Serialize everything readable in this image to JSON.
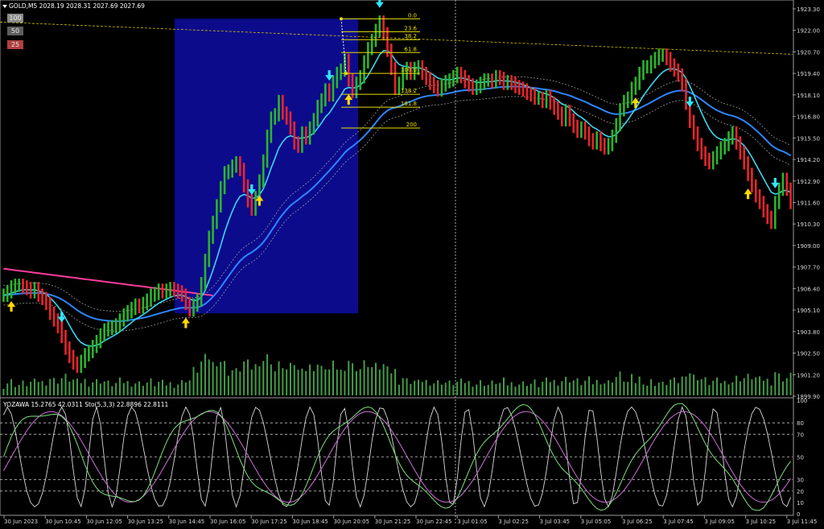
{
  "header": {
    "symbol_line": "GOLD,M5  2028.19 2028.31 2027.69 2027.69",
    "sub_line": "YOZAWA 15.2765 42.0311   Sto(5,3,3) 22.8896 22.8111"
  },
  "buttons": [
    {
      "label": "100",
      "bg": "#8a8a8a"
    },
    {
      "label": "50",
      "bg": "#5e5e5e"
    },
    {
      "label": "25",
      "bg": "#b04040"
    }
  ],
  "chart_data": {
    "type": "line",
    "price_axis": {
      "ticks": [
        "1923.30",
        "1922.00",
        "1920.70",
        "1919.40",
        "1918.10",
        "1916.80",
        "1915.50",
        "1914.20",
        "1912.90",
        "1911.60",
        "1910.30",
        "1909.00",
        "1907.70",
        "1906.40",
        "1905.10",
        "1903.80",
        "1902.50",
        "1901.20",
        "1899.90"
      ],
      "min": 1899.9,
      "max": 1923.3
    },
    "sub_axis": {
      "ticks": [
        "100",
        "80",
        "70",
        "50",
        "30",
        "20",
        "10",
        "0"
      ],
      "levels": [
        80,
        70,
        50,
        30,
        20
      ],
      "min": 0,
      "max": 100
    },
    "time_axis": [
      "30 Jun 2023",
      "30 Jun 10:45",
      "30 Jun 12:05",
      "30 Jun 13:25",
      "30 Jun 14:45",
      "30 Jun 16:05",
      "30 Jun 17:25",
      "30 Jun 18:45",
      "30 Jun 20:05",
      "30 Jun 21:25",
      "30 Jun 22:45",
      "3 Jul 01:05",
      "3 Jul 02:25",
      "3 Jul 03:45",
      "3 Jul 05:05",
      "3 Jul 06:25",
      "3 Jul 07:45",
      "3 Jul 09:05",
      "3 Jul 10:25",
      "3 Jul 11:45"
    ],
    "fibonacci": {
      "levels": [
        "0.0",
        "23.6",
        "38.2",
        "61.8",
        "100.0",
        "138.2",
        "161.8",
        "200"
      ],
      "high": 1922.7,
      "low": 1919.4
    },
    "current_price_level": 1922.5,
    "closes": [
      1906.0,
      1906.2,
      1906.5,
      1906.6,
      1906.6,
      1906.5,
      1906.4,
      1906.2,
      1906.4,
      1906.0,
      1905.8,
      1905.5,
      1904.9,
      1904.5,
      1904.1,
      1903.5,
      1902.8,
      1902.3,
      1901.9,
      1901.7,
      1902.0,
      1902.4,
      1902.6,
      1902.9,
      1903.2,
      1903.6,
      1903.9,
      1904.0,
      1904.1,
      1904.2,
      1904.5,
      1904.8,
      1905.0,
      1905.2,
      1905.4,
      1905.3,
      1905.5,
      1905.7,
      1906.0,
      1906.1,
      1906.3,
      1906.2,
      1906.3,
      1906.4,
      1906.3,
      1906.2,
      1906.0,
      1905.5,
      1905.1,
      1905.4,
      1905.7,
      1906.7,
      1908.1,
      1909.5,
      1910.4,
      1911.4,
      1912.5,
      1913.4,
      1913.5,
      1913.8,
      1914.0,
      1913.6,
      1912.6,
      1911.7,
      1911.2,
      1911.9,
      1912.9,
      1914.1,
      1915.6,
      1916.7,
      1916.9,
      1917.7,
      1917.0,
      1916.7,
      1916.1,
      1915.2,
      1915.0,
      1915.8,
      1915.5,
      1916.1,
      1916.6,
      1917.4,
      1917.8,
      1918.4,
      1918.1,
      1918.9,
      1919.4,
      1919.6,
      1920.2,
      1919.0,
      1918.3,
      1918.8,
      1919.2,
      1920.1,
      1920.9,
      1921.4,
      1922.0,
      1922.5,
      1921.8,
      1920.8,
      1919.7,
      1918.5,
      1918.8,
      1919.4,
      1919.7,
      1919.4,
      1919.7,
      1919.8,
      1919.4,
      1919.1,
      1918.8,
      1918.6,
      1918.4,
      1918.7,
      1918.9,
      1919.0,
      1919.2,
      1919.4,
      1919.2,
      1918.9,
      1918.7,
      1918.5,
      1918.6,
      1918.8,
      1919.0,
      1919.0,
      1918.9,
      1919.2,
      1919.1,
      1918.8,
      1918.9,
      1918.8,
      1918.6,
      1918.5,
      1918.4,
      1918.2,
      1918.1,
      1917.9,
      1917.9,
      1917.7,
      1918.0,
      1917.6,
      1917.3,
      1917.0,
      1916.6,
      1917.1,
      1916.6,
      1916.2,
      1915.9,
      1916.1,
      1915.8,
      1915.4,
      1915.2,
      1915.5,
      1915.1,
      1914.9,
      1915.1,
      1915.6,
      1916.3,
      1917.2,
      1917.7,
      1917.9,
      1918.5,
      1918.8,
      1919.4,
      1919.8,
      1919.8,
      1920.1,
      1920.3,
      1920.5,
      1920.5,
      1920.3,
      1919.9,
      1919.6,
      1919.3,
      1918.7,
      1917.6,
      1916.5,
      1915.8,
      1915.1,
      1914.6,
      1914.2,
      1914.0,
      1914.3,
      1914.6,
      1914.9,
      1915.1,
      1915.5,
      1915.8,
      1915.2,
      1914.6,
      1914.0,
      1913.3,
      1912.6,
      1912.0,
      1911.6,
      1911.1,
      1910.7,
      1910.4,
      1911.6,
      1912.4,
      1913.0,
      1912.4,
      1911.6
    ]
  }
}
